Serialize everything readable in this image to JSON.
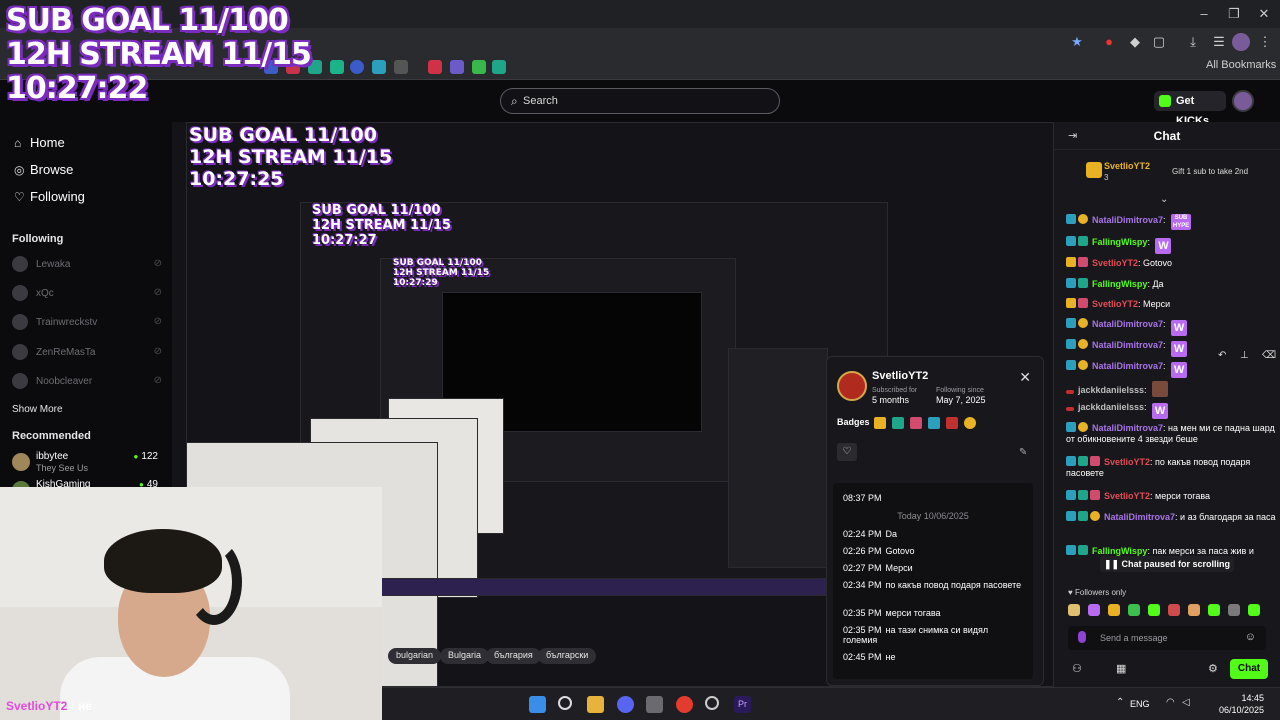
{
  "overlay": {
    "line1": "SUB GOAL 11/100",
    "line2": "12H STREAM 11/15",
    "line3": "10:27:22"
  },
  "nested_overlays": [
    {
      "line1": "SUB GOAL 11/100",
      "line2": "12H STREAM 11/15",
      "line3": "10:27:25"
    },
    {
      "line1": "SUB GOAL 11/100",
      "line2": "12H STREAM 11/15",
      "line3": "10:27:27"
    },
    {
      "line1": "SUB GOAL 11/100",
      "line2": "12H STREAM 11/15",
      "line3": "10:27:29"
    }
  ],
  "browser": {
    "all_bookmarks": "All Bookmarks"
  },
  "header": {
    "search_placeholder": "Search",
    "get_kicks": "Get KICKs"
  },
  "sidebar": {
    "nav": [
      {
        "label": "Home",
        "icon": "home-icon"
      },
      {
        "label": "Browse",
        "icon": "compass-icon"
      },
      {
        "label": "Following",
        "icon": "heart-icon"
      }
    ],
    "following_title": "Following",
    "following": [
      {
        "name": "Lewaka"
      },
      {
        "name": "xQc"
      },
      {
        "name": "Trainwreckstv"
      },
      {
        "name": "ZenReMasTa"
      },
      {
        "name": "Noobcleaver"
      }
    ],
    "show_more": "Show More",
    "recommended_title": "Recommended",
    "recommended": [
      {
        "name": "ibbytee",
        "subtitle": "They See Us",
        "viewers": "122"
      },
      {
        "name": "KishGaming",
        "subtitle": "",
        "viewers": "49"
      }
    ]
  },
  "user_card": {
    "username": "SvetlioYT2",
    "subscribed_label": "Subscribed for",
    "subscribed_value": "5 months",
    "following_label": "Following since",
    "following_value": "May 7, 2025",
    "badges_label": "Badges",
    "log": {
      "first_time": "08:37 PM",
      "date_divider": "Today 10/06/2025",
      "lines": [
        {
          "time": "02:24 PM",
          "text": "Da"
        },
        {
          "time": "02:26 PM",
          "text": "Gotovo"
        },
        {
          "time": "02:27 PM",
          "text": "Мерси"
        },
        {
          "time": "02:34 PM",
          "text": "по какъв повод подаря пасовете"
        },
        {
          "time": "02:35 PM",
          "text": "мерси тогава"
        },
        {
          "time": "02:35 PM",
          "text": "на тази снимка си видял големия"
        },
        {
          "time": "02:45 PM",
          "text": "не"
        }
      ]
    }
  },
  "tags": [
    "bulgarian",
    "Bulgaria",
    "българия",
    "български"
  ],
  "chat": {
    "title": "Chat",
    "pinned": {
      "user": "SvetlioYT2",
      "count": "3",
      "text": "Gift 1 sub to take 2nd"
    },
    "messages": [
      {
        "user": "NataliDimitrova7",
        "cls": "u-nat",
        "text": "",
        "emote": "SUB HYPE"
      },
      {
        "user": "FallingWispy",
        "cls": "u-fal",
        "text": "",
        "emote": "W"
      },
      {
        "user": "SvetlioYT2",
        "cls": "u-sve",
        "text": "Gotovo",
        "emote": ""
      },
      {
        "user": "FallingWispy",
        "cls": "u-fal",
        "text": "Да",
        "emote": ""
      },
      {
        "user": "SvetlioYT2",
        "cls": "u-sve",
        "text": "Мерси",
        "emote": ""
      },
      {
        "user": "NataliDimitrova7",
        "cls": "u-nat",
        "text": "",
        "emote": "W"
      },
      {
        "user": "NataliDimitrova7",
        "cls": "u-nat",
        "text": "",
        "emote": "W"
      },
      {
        "user": "NataliDimitrova7",
        "cls": "u-nat",
        "text": "",
        "emote": "W"
      },
      {
        "user": "jackkdaniielsss",
        "cls": "u-jac",
        "text": "",
        "emote": ""
      },
      {
        "user": "jackkdaniielsss",
        "cls": "u-jac",
        "text": "",
        "emote": "W"
      },
      {
        "user": "NataliDimitrova7",
        "cls": "u-nat",
        "text": "на мен ми се падна шард от обикновените 4 звезди беше",
        "emote": ""
      },
      {
        "user": "SvetlioYT2",
        "cls": "u-sve",
        "text": "по какъв повод подаря пасовете",
        "emote": ""
      },
      {
        "user": "SvetlioYT2",
        "cls": "u-sve",
        "text": "мерси тогава",
        "emote": ""
      },
      {
        "user": "NataliDimitrova7",
        "cls": "u-nat",
        "text": "и аз благодаря за паса",
        "emote": ""
      },
      {
        "user": "FallingWispy",
        "cls": "u-fal",
        "text": "пак мерси за паса жив и",
        "emote": ""
      }
    ],
    "paused": "Chat paused for scrolling",
    "followers_only": "Followers only",
    "input_placeholder": "Send a message",
    "send": "Chat"
  },
  "cam_chat": {
    "user": "SvetlioYT2",
    "text": "не"
  },
  "taskbar": {
    "lang": "ENG",
    "time": "14:45",
    "date": "06/10/2025"
  },
  "colors": {
    "kick_green": "#53fc18",
    "overlay_purple": "#7b2cbf",
    "chat_bg": "#18181c"
  }
}
